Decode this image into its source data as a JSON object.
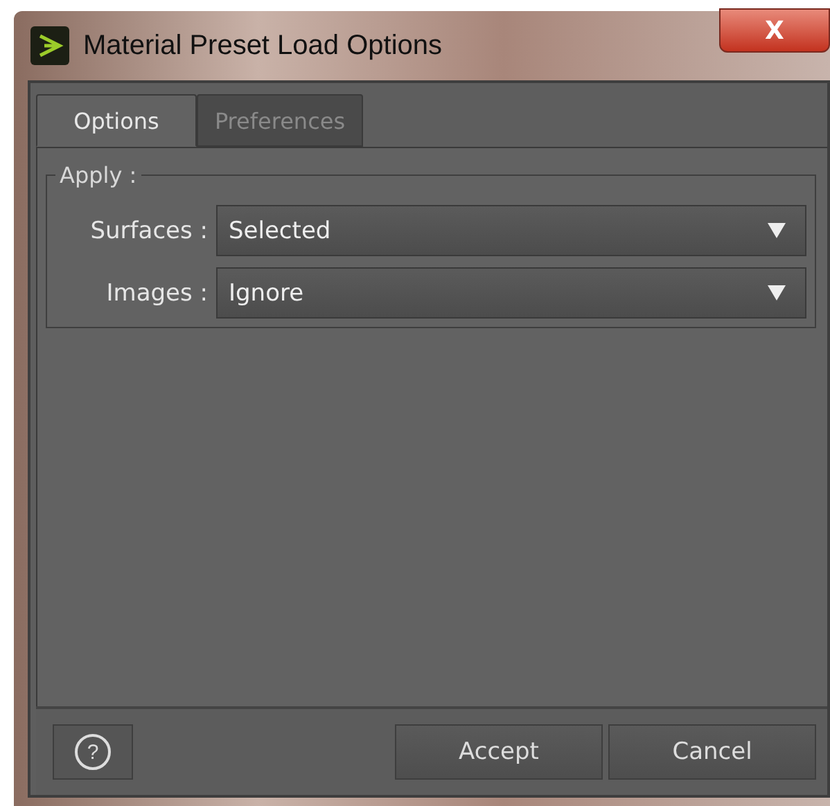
{
  "window": {
    "title": "Material Preset Load Options",
    "close_icon": "X"
  },
  "tabs": [
    {
      "label": "Options",
      "selected": true
    },
    {
      "label": "Preferences",
      "selected": false
    }
  ],
  "group": {
    "title": "Apply :",
    "fields": [
      {
        "label": "Surfaces :",
        "value": "Selected"
      },
      {
        "label": "Images :",
        "value": "Ignore"
      }
    ]
  },
  "footer": {
    "help": "?",
    "buttons": [
      "Accept",
      "Cancel"
    ]
  }
}
